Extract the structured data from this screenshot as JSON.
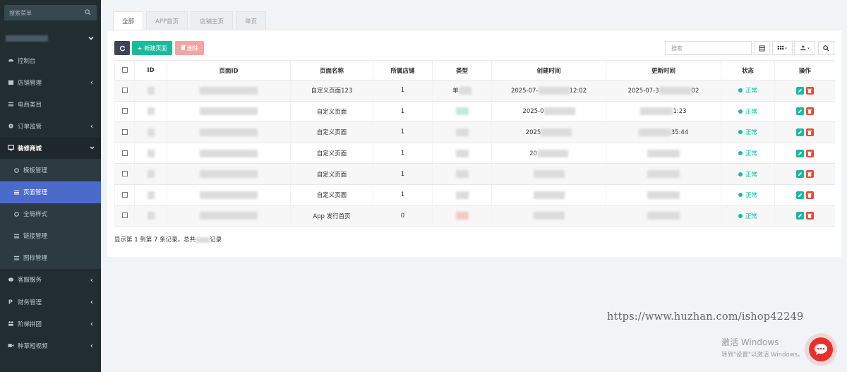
{
  "sidebar": {
    "search_placeholder": "搜索菜单",
    "menu": [
      {
        "label": "控制台",
        "icon": "dashboard-icon"
      },
      {
        "label": "店铺管理",
        "icon": "store-icon"
      },
      {
        "label": "电商类目",
        "icon": "list-icon"
      },
      {
        "label": "订单监管",
        "icon": "gear-icon"
      },
      {
        "label": "装修商城",
        "icon": "monitor-icon"
      },
      {
        "label": "模板管理",
        "icon": "circle-icon"
      },
      {
        "label": "页面管理",
        "icon": "list-icon"
      },
      {
        "label": "全局样式",
        "icon": "circle-icon"
      },
      {
        "label": "链接管理",
        "icon": "list-icon"
      },
      {
        "label": "图标管理",
        "icon": "list-icon"
      },
      {
        "label": "客服服务",
        "icon": "chat-icon"
      },
      {
        "label": "财务管理",
        "icon": "paypal-icon"
      },
      {
        "label": "阶梯拼团",
        "icon": "group-icon"
      },
      {
        "label": "种草短视频",
        "icon": "video-icon"
      }
    ]
  },
  "tabs": [
    "全部",
    "APP首页",
    "店铺主页",
    "单页"
  ],
  "toolbar": {
    "add_label": "新建页面",
    "delete_label": "删除",
    "search_placeholder": "搜索"
  },
  "table": {
    "headers": [
      "ID",
      "页面ID",
      "页面名称",
      "所属店铺",
      "类型",
      "创建时间",
      "更新时间",
      "状态",
      "操作"
    ],
    "rows": [
      {
        "name": "自定义页面123",
        "shop": "1",
        "type": "单",
        "created": "2025-07-",
        "created_end": "12:02",
        "updated": "2025-07-3",
        "updated_end": "02",
        "status": "正常"
      },
      {
        "name": "自定义页面",
        "shop": "1",
        "type": "",
        "created": "2025-0",
        "created_end": "",
        "updated": "",
        "updated_end": "1:23",
        "status": "正常"
      },
      {
        "name": "自定义页面",
        "shop": "1",
        "type": "",
        "created": "2025",
        "created_end": "",
        "updated": "",
        "updated_end": "35:44",
        "status": "正常"
      },
      {
        "name": "自定义页面",
        "shop": "1",
        "type": "",
        "created": "20",
        "created_end": "",
        "updated": "",
        "updated_end": "",
        "status": "正常"
      },
      {
        "name": "自定义页面",
        "shop": "1",
        "type": "",
        "created": "",
        "created_end": "",
        "updated": "",
        "updated_end": "",
        "status": "正常"
      },
      {
        "name": "自定义页面",
        "shop": "1",
        "type": "",
        "created": "",
        "created_end": "",
        "updated": "",
        "updated_end": "",
        "status": "正常"
      },
      {
        "name": "App 发行首页",
        "shop": "0",
        "type": "",
        "created": "",
        "created_end": "",
        "updated": "",
        "updated_end": "",
        "status": "正常"
      }
    ]
  },
  "pager": {
    "info": "显示第 1 到第 7 条记录，总共"
  },
  "overlay": {
    "url": "https://www.huzhan.com/ishop42249",
    "win_title": "激活 Windows",
    "win_sub": "转到\"设置\"以激活 Windows。"
  }
}
